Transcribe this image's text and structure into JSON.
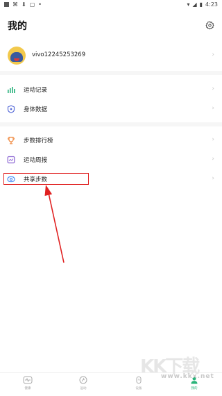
{
  "status": {
    "time": "4:23"
  },
  "header": {
    "title": "我的"
  },
  "profile": {
    "username": "vivo12245253269"
  },
  "menu": {
    "group1": [
      {
        "label": "运动记录",
        "icon": "bar-chart-icon",
        "color": "#26b07a"
      },
      {
        "label": "身体数据",
        "icon": "shield-icon",
        "color": "#5b6fd9"
      }
    ],
    "group2": [
      {
        "label": "步数排行榜",
        "icon": "trophy-icon",
        "color": "#f0883e"
      },
      {
        "label": "运动周报",
        "icon": "report-icon",
        "color": "#8a63d2"
      },
      {
        "label": "共享步数",
        "icon": "share-steps-icon",
        "color": "#4a8df6"
      }
    ]
  },
  "bottom_nav": [
    {
      "label": "健康",
      "icon": "heartbeat-icon",
      "active": false
    },
    {
      "label": "运动",
      "icon": "run-icon",
      "active": false
    },
    {
      "label": "设备",
      "icon": "watch-icon",
      "active": false
    },
    {
      "label": "我的",
      "icon": "person-icon",
      "active": true
    }
  ],
  "colors": {
    "accent": "#2ab47a",
    "highlight": "#e02020"
  },
  "watermark": {
    "text": "www.kkx.net",
    "logo": "KK下载"
  }
}
